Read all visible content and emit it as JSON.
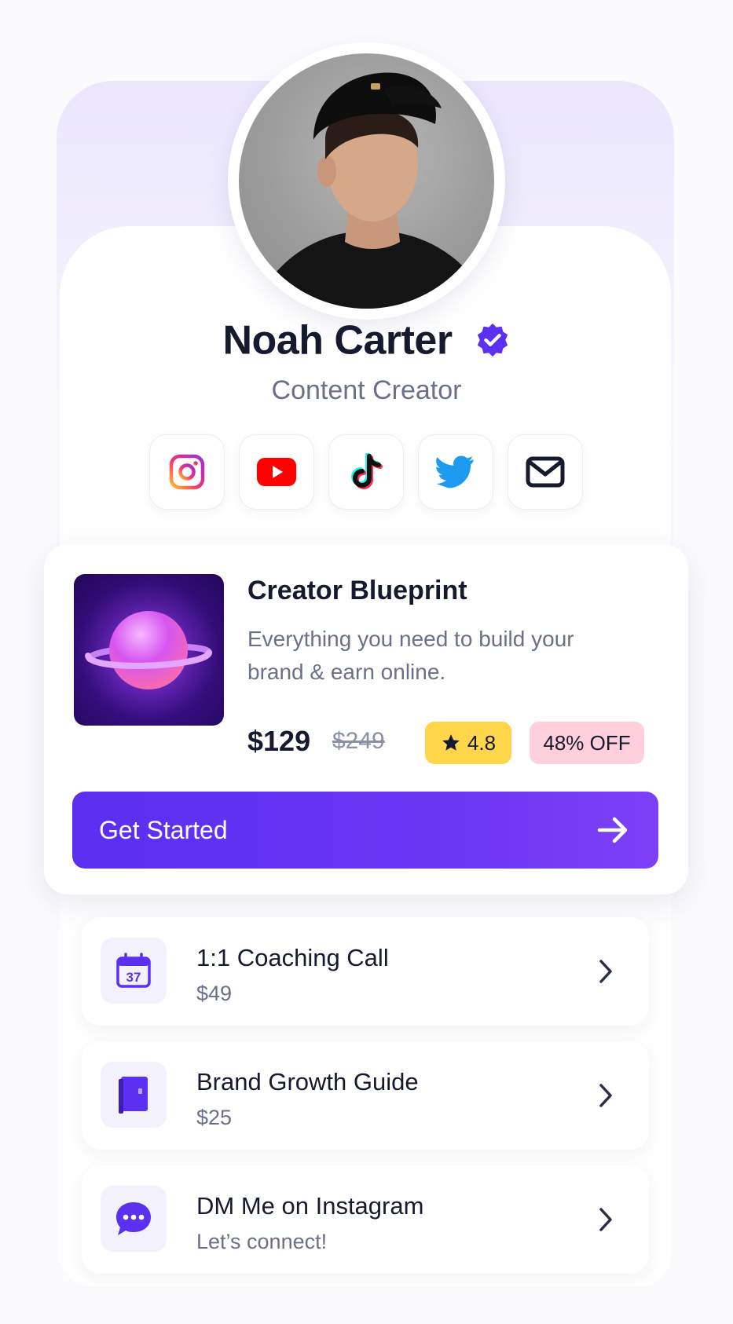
{
  "profile": {
    "name": "Noah Carter",
    "role": "Content Creator",
    "verified": true
  },
  "socials": [
    {
      "icon": "instagram-icon"
    },
    {
      "icon": "youtube-icon"
    },
    {
      "icon": "tiktok-icon"
    },
    {
      "icon": "twitter-icon"
    },
    {
      "icon": "mail-icon"
    }
  ],
  "featured": {
    "title": "Creator Blueprint",
    "description": "Everything you need to build your brand & earn online.",
    "price": "$129",
    "old_price": "$249",
    "rating": "4.8",
    "discount": "48% OFF",
    "cta": "Get Started"
  },
  "offers": [
    {
      "title": "1:1 Coaching Call",
      "subtitle": "$49",
      "icon": "calendar-icon",
      "calendar_day": "37"
    },
    {
      "title": "Brand Growth Guide",
      "subtitle": "$25",
      "icon": "book-icon"
    },
    {
      "title": "DM Me on Instagram",
      "subtitle": "Let’s connect!",
      "icon": "chat-bubble-icon"
    }
  ],
  "colors": {
    "accent": "#5b30f0",
    "rating_badge": "#ffd54a",
    "discount_badge": "#ffcfdc",
    "text_primary": "#151a2e",
    "text_secondary": "#6a7088"
  }
}
